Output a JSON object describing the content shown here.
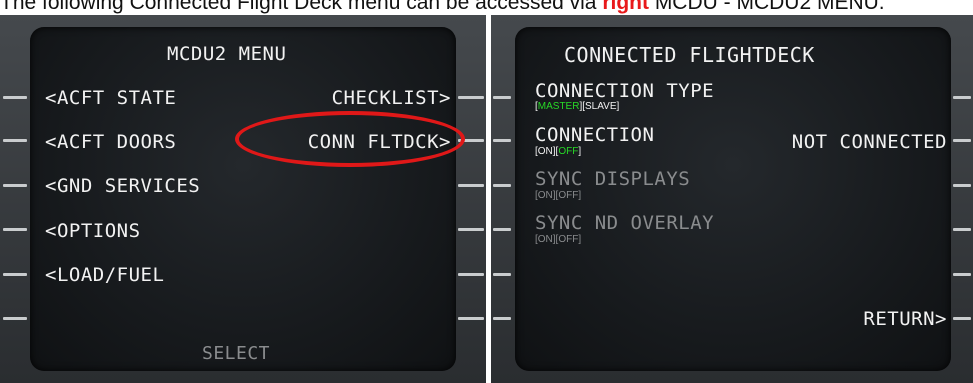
{
  "caption": {
    "before": "The following Connected Flight Deck menu can be accessed via ",
    "highlight": "right",
    "after": " MCDU - MCDU2 MENU."
  },
  "left_screen": {
    "title": "MCDU2 MENU",
    "items": {
      "acft_state": "<ACFT STATE",
      "checklist": "CHECKLIST>",
      "acft_doors": "<ACFT DOORS",
      "conn_fltdck": "CONN FLTDCK>",
      "gnd_services": "<GND SERVICES",
      "options": "<OPTIONS",
      "load_fuel": "<LOAD/FUEL"
    },
    "scratchpad": "SELECT"
  },
  "right_screen": {
    "title": "CONNECTED FLIGHTDECK",
    "connection_type": {
      "label": "CONNECTION TYPE",
      "opt_open": "[",
      "opt_a": "MASTER",
      "opt_mid": "][",
      "opt_b": "SLAVE",
      "opt_close": "]"
    },
    "connection": {
      "label": "CONNECTION",
      "opt_open": "[",
      "opt_a": "ON",
      "opt_mid": "][",
      "opt_b": "OFF",
      "opt_close": "]",
      "status": "NOT CONNECTED"
    },
    "sync_displays": {
      "label": "SYNC DISPLAYS",
      "options": "[ON][OFF]"
    },
    "sync_nd_overlay": {
      "label": "SYNC ND OVERLAY",
      "options": "[ON][OFF]"
    },
    "return": "RETURN>"
  },
  "colors": {
    "highlight_red": "#e01818",
    "active_green": "#27d827",
    "text_white": "#f2f2f2",
    "text_disabled": "#8a8c8e"
  }
}
